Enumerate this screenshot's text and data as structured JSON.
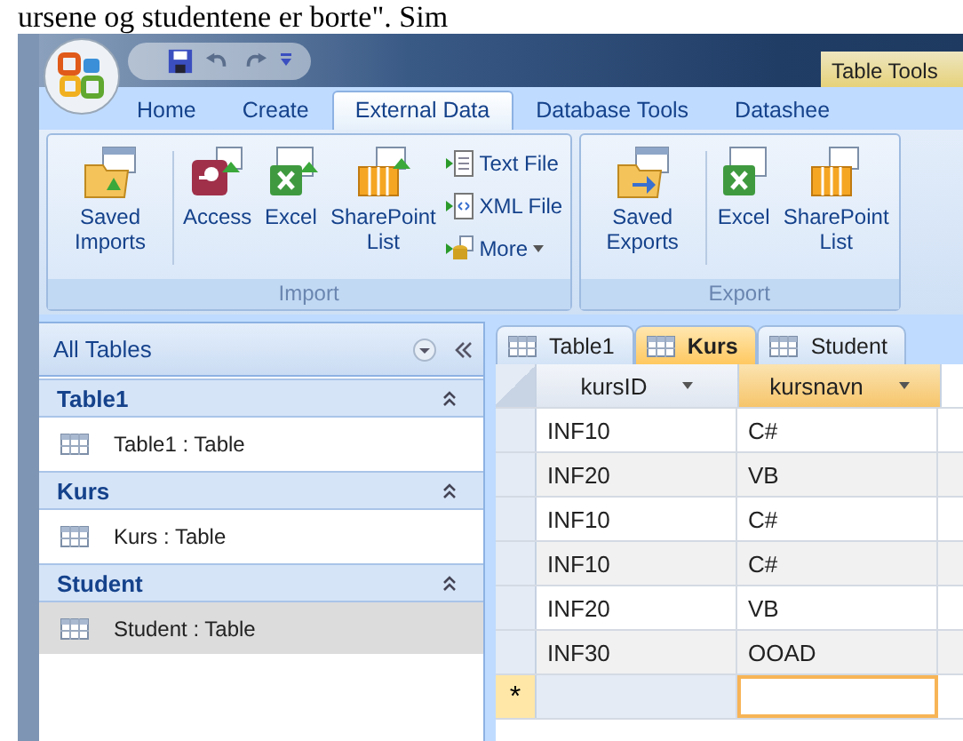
{
  "document_text": "ursene og studentene er borte\". Sim",
  "window": {
    "context_tab_group": "Table Tools"
  },
  "ribbon_tabs": [
    {
      "label": "Home",
      "selected": false
    },
    {
      "label": "Create",
      "selected": false
    },
    {
      "label": "External Data",
      "selected": true
    },
    {
      "label": "Database Tools",
      "selected": false
    },
    {
      "label": "Datashee",
      "selected": false
    }
  ],
  "ribbon_groups": [
    {
      "label": "Import",
      "large_buttons": [
        {
          "label": "Saved Imports",
          "kind": "saved-import"
        },
        {
          "label": "Access",
          "kind": "access"
        },
        {
          "label": "Excel",
          "kind": "excel"
        },
        {
          "label": "SharePoint List",
          "kind": "sharepoint"
        }
      ],
      "small_buttons": [
        {
          "label": "Text File",
          "kind": "text"
        },
        {
          "label": "XML File",
          "kind": "xml"
        },
        {
          "label": "More",
          "kind": "more",
          "dropdown": true
        }
      ]
    },
    {
      "label": "Export",
      "large_buttons": [
        {
          "label": "Saved Exports",
          "kind": "saved-export"
        },
        {
          "label": "Excel",
          "kind": "excel-export"
        },
        {
          "label": "SharePoint List",
          "kind": "sharepoint-export"
        }
      ]
    }
  ],
  "navigation_pane": {
    "title": "All Tables",
    "groups": [
      {
        "name": "Table1",
        "items": [
          {
            "label": "Table1 : Table",
            "selected": false
          }
        ]
      },
      {
        "name": "Kurs",
        "items": [
          {
            "label": "Kurs : Table",
            "selected": false
          }
        ]
      },
      {
        "name": "Student",
        "items": [
          {
            "label": "Student : Table",
            "selected": true
          }
        ]
      }
    ]
  },
  "datasheet": {
    "tabs": [
      {
        "label": "Table1",
        "selected": false
      },
      {
        "label": "Kurs",
        "selected": true
      },
      {
        "label": "Student",
        "selected": false
      }
    ],
    "columns": [
      {
        "label": "kursID",
        "selected": false
      },
      {
        "label": "kursnavn",
        "selected": true
      }
    ],
    "rows": [
      [
        "INF10",
        "C#"
      ],
      [
        "INF20",
        "VB"
      ],
      [
        "INF10",
        "C#"
      ],
      [
        "INF10",
        "C#"
      ],
      [
        "INF20",
        "VB"
      ],
      [
        "INF30",
        "OOAD"
      ]
    ],
    "new_record_marker": "*"
  }
}
